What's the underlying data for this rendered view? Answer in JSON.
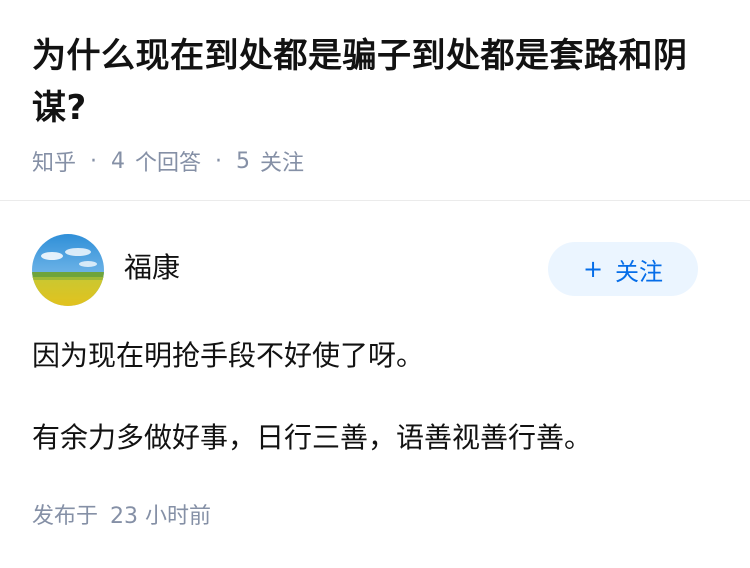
{
  "question": {
    "title": "为什么现在到处都是骗子到处都是套路和阴谋?",
    "source": "知乎",
    "answers_count": "4",
    "answers_label": "个回答",
    "follows_count": "5",
    "follows_label": "关注",
    "separator": "·"
  },
  "answer": {
    "author": {
      "name": "福康",
      "avatar_icon": "landscape-avatar-icon"
    },
    "follow_button": {
      "icon": "+",
      "label": "关注"
    },
    "paragraphs": [
      "因为现在明抢手段不好使了呀。",
      "有余力多做好事，日行三善，语善视善行善。"
    ],
    "published_label": "发布于",
    "published_time": "23 小时前"
  },
  "colors": {
    "title_text": "#121212",
    "meta_text": "#8590a6",
    "follow_bg": "#ebf5ff",
    "follow_text": "#056de8",
    "divider": "#ebebeb"
  }
}
